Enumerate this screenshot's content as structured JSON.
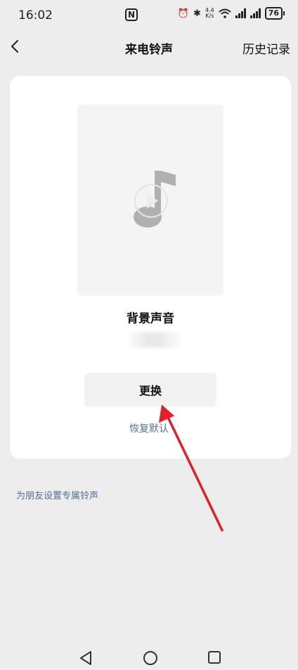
{
  "status_bar": {
    "time": "16:02",
    "nfc": "N",
    "net_speed_top": "4.4",
    "net_speed_bottom": "K/s",
    "battery": "76"
  },
  "nav": {
    "title": "来电铃声",
    "history": "历史记录"
  },
  "card": {
    "sound_name": "背景声音",
    "change_label": "更换",
    "restore_label": "恢复默认"
  },
  "friend_link": "为朋友设置专属铃声",
  "colors": {
    "link": "#5a6e92",
    "annotation_arrow": "#e0202a",
    "background": "#ededed"
  }
}
